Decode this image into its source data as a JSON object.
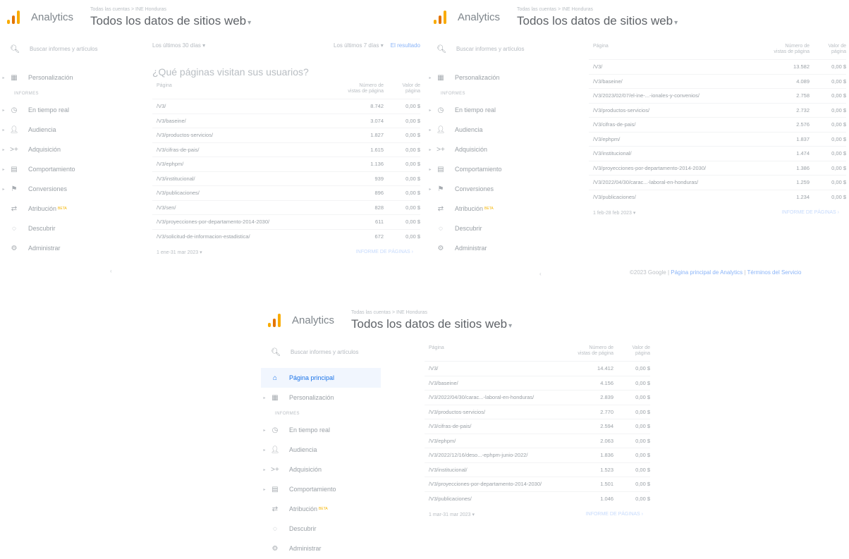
{
  "brand": "Analytics",
  "breadcrumb": "Todas las cuentas > INE Honduras",
  "view_title": "Todos los datos de sitios web",
  "search_placeholder": "Buscar informes y artículos",
  "nav": {
    "home": "Página principal",
    "custom": "Personalización",
    "section": "INFORMES",
    "realtime": "En tiempo real",
    "audience": "Audiencia",
    "acquisition": "Adquisición",
    "behavior": "Comportamiento",
    "conversions": "Conversiones",
    "attribution": "Atribución",
    "beta": "BETA",
    "discover": "Descubrir",
    "admin": "Administrar"
  },
  "panel1": {
    "range_left": "Los últimos 30 días ▾",
    "range_right": "Los últimos 7 días ▾",
    "range_link": "El resultado",
    "question": "¿Qué páginas visitan sus usuarios?",
    "col_page": "Página",
    "col_views": "Número de vistas de página",
    "col_value": "Valor de página",
    "rows": [
      {
        "page": "/V3/",
        "views": "8.742",
        "value": "0,00 $"
      },
      {
        "page": "/V3/baseine/",
        "views": "3.074",
        "value": "0,00 $"
      },
      {
        "page": "/V3/productos-servicios/",
        "views": "1.827",
        "value": "0,00 $"
      },
      {
        "page": "/V3/cifras-de-pais/",
        "views": "1.615",
        "value": "0,00 $"
      },
      {
        "page": "/V3/ephpm/",
        "views": "1.136",
        "value": "0,00 $"
      },
      {
        "page": "/V3/institucional/",
        "views": "939",
        "value": "0,00 $"
      },
      {
        "page": "/V3/publicaciones/",
        "views": "896",
        "value": "0,00 $"
      },
      {
        "page": "/V3/sen/",
        "views": "828",
        "value": "0,00 $"
      },
      {
        "page": "/V3/proyecciones-por-departamento-2014-2030/",
        "views": "611",
        "value": "0,00 $"
      },
      {
        "page": "/V3/solicitud-de-informacion-estadistica/",
        "views": "672",
        "value": "0,00 $"
      }
    ],
    "foot_range": "1 ene-31 mar 2023 ▾",
    "foot_link": "INFORME DE PÁGINAS ›"
  },
  "panel2": {
    "col_page": "Página",
    "col_views": "Número de vistas de página",
    "col_value": "Valor de página",
    "rows": [
      {
        "page": "/V3/",
        "views": "13.582",
        "value": "0,00 $"
      },
      {
        "page": "/V3/baseine/",
        "views": "4.089",
        "value": "0,00 $"
      },
      {
        "page": "/V3/2023/02/07/el-ine-...-ionales-y-convenios/",
        "views": "2.758",
        "value": "0,00 $"
      },
      {
        "page": "/V3/productos-servicios/",
        "views": "2.732",
        "value": "0,00 $"
      },
      {
        "page": "/V3/cifras-de-pais/",
        "views": "2.576",
        "value": "0,00 $"
      },
      {
        "page": "/V3/ephpm/",
        "views": "1.837",
        "value": "0,00 $"
      },
      {
        "page": "/V3/institucional/",
        "views": "1.474",
        "value": "0,00 $"
      },
      {
        "page": "/V3/proyecciones-por-departamento-2014-2030/",
        "views": "1.386",
        "value": "0,00 $"
      },
      {
        "page": "/V3/2022/04/30/carac...-laboral-en-honduras/",
        "views": "1.259",
        "value": "0,00 $"
      },
      {
        "page": "/V3/publicaciones/",
        "views": "1.234",
        "value": "0,00 $"
      }
    ],
    "foot_range": "1 feb-28 feb 2023 ▾",
    "foot_link": "INFORME DE PÁGINAS ›"
  },
  "panel3": {
    "col_page": "Página",
    "col_views": "Número de vistas de página",
    "col_value": "Valor de página",
    "rows": [
      {
        "page": "/V3/",
        "views": "14.412",
        "value": "0,00 $"
      },
      {
        "page": "/V3/baseine/",
        "views": "4.156",
        "value": "0,00 $"
      },
      {
        "page": "/V3/2022/04/30/carac...-laboral-en-honduras/",
        "views": "2.839",
        "value": "0,00 $"
      },
      {
        "page": "/V3/productos-servicios/",
        "views": "2.770",
        "value": "0,00 $"
      },
      {
        "page": "/V3/cifras-de-pais/",
        "views": "2.594",
        "value": "0,00 $"
      },
      {
        "page": "/V3/ephpm/",
        "views": "2.063",
        "value": "0,00 $"
      },
      {
        "page": "/V3/2022/12/16/deso...-ephpm-junio-2022/",
        "views": "1.836",
        "value": "0,00 $"
      },
      {
        "page": "/V3/institucional/",
        "views": "1.523",
        "value": "0,00 $"
      },
      {
        "page": "/V3/proyecciones-por-departamento-2014-2030/",
        "views": "1.501",
        "value": "0,00 $"
      },
      {
        "page": "/V3/publicaciones/",
        "views": "1.046",
        "value": "0,00 $"
      }
    ],
    "foot_range": "1 mar-31 mar 2023 ▾",
    "foot_link": "INFORME DE PÁGINAS ›"
  },
  "footer": {
    "copyright": "©2023 Google",
    "home_link": "Página principal de Analytics",
    "terms_link": "Términos del Servicio"
  }
}
